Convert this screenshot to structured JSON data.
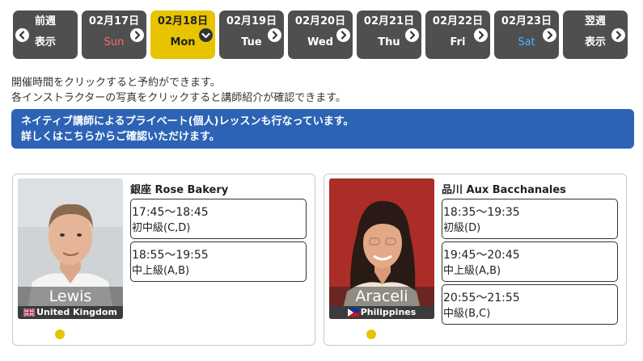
{
  "day_nav": {
    "prev": {
      "line1": "前週",
      "line2": "表示"
    },
    "days": [
      {
        "date": "02月17日",
        "weekday": "Sun",
        "tone": "sun",
        "selected": false
      },
      {
        "date": "02月18日",
        "weekday": "Mon",
        "tone": "normal",
        "selected": true
      },
      {
        "date": "02月19日",
        "weekday": "Tue",
        "tone": "normal",
        "selected": false
      },
      {
        "date": "02月20日",
        "weekday": "Wed",
        "tone": "normal",
        "selected": false
      },
      {
        "date": "02月21日",
        "weekday": "Thu",
        "tone": "normal",
        "selected": false
      },
      {
        "date": "02月22日",
        "weekday": "Fri",
        "tone": "normal",
        "selected": false
      },
      {
        "date": "02月23日",
        "weekday": "Sat",
        "tone": "sat",
        "selected": false
      }
    ],
    "next": {
      "line1": "翌週",
      "line2": "表示"
    }
  },
  "info": {
    "line1": "開催時間をクリックすると予約ができます。",
    "line2": "各インストラクターの写真をクリックすると講師紹介が確認できます。"
  },
  "banner": {
    "line1": "ネイティブ講師によるプライベート(個人)レッスンも行なっています。",
    "line2": "詳しくはこちらからご確認いただけます。"
  },
  "colors": {
    "selected_day": "#e8c400",
    "nav_day": "#4f4f4f",
    "banner": "#2c63b5",
    "sunday": "#ff6b6b",
    "saturday": "#4db2ff",
    "status_dot": "#e8c400"
  },
  "instructors": [
    {
      "name": "Lewis",
      "country": "United Kingdom",
      "studio": "銀座 Rose Bakery",
      "slots": [
        {
          "time": "17:45〜18:45",
          "level": "初中級(C,D)"
        },
        {
          "time": "18:55〜19:55",
          "level": "中上級(A,B)"
        }
      ]
    },
    {
      "name": "Araceli",
      "country": "Philippines",
      "studio": "品川 Aux Bacchanales",
      "slots": [
        {
          "time": "18:35〜19:35",
          "level": "初級(D)"
        },
        {
          "time": "19:45〜20:45",
          "level": "中上級(A,B)"
        },
        {
          "time": "20:55〜21:55",
          "level": "中級(B,C)"
        }
      ]
    }
  ]
}
